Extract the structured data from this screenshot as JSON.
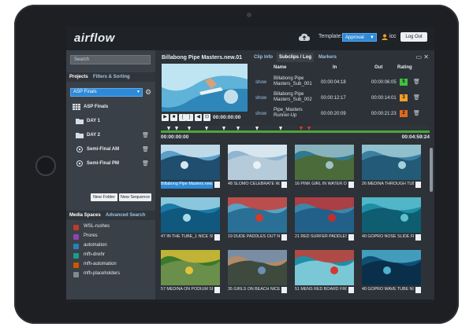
{
  "app": {
    "logo": "airflow"
  },
  "header": {
    "template_label": "Template:",
    "template_value": "Approval",
    "user": "icc",
    "logout": "Log Out"
  },
  "left": {
    "search_placeholder": "Search",
    "tabs": [
      "Projects",
      "Filters & Sorting"
    ],
    "project_select": "ASP Finals",
    "tree": [
      {
        "label": "ASP Finals",
        "icon": "grid-icon",
        "trash": false
      },
      {
        "label": "DAY 1",
        "icon": "folder-icon",
        "trash": false
      },
      {
        "label": "DAY 2",
        "icon": "folder-icon",
        "trash": true
      },
      {
        "label": "Semi-Final AM",
        "icon": "sequence-icon",
        "trash": true
      },
      {
        "label": "Semi-Final PM",
        "icon": "sequence-icon",
        "trash": true
      }
    ],
    "new_folder": "New Folder",
    "new_sequence": "New Sequence",
    "tabs2": [
      "Media Spaces",
      "Advanced Search"
    ],
    "media_spaces": [
      {
        "label": "WSL-rushes",
        "color": "#c0392b"
      },
      {
        "label": "Prores",
        "color": "#8e44ad"
      },
      {
        "label": "automation",
        "color": "#2980b9"
      },
      {
        "label": "mfh-dnxhr",
        "color": "#16a085"
      },
      {
        "label": "mfh-automation",
        "color": "#d35400"
      },
      {
        "label": "mfh-placeholders",
        "color": "#7f8c8d"
      }
    ]
  },
  "viewer": {
    "title": "Billabong Pipe Masters.new.01",
    "timecode": "00:00:00:00"
  },
  "right": {
    "tabs": [
      "Clip Info",
      "Subclips / Log",
      "Markers"
    ],
    "active_tab": 1,
    "headers": {
      "name": "Name",
      "in": "In",
      "out": "Out",
      "rating": "Rating"
    },
    "rows": [
      {
        "show": "show",
        "name": "Billabong Pipe Masters_Sub_001",
        "in": "00:00:04:18",
        "out": "00:00:06:05",
        "rating": "5",
        "rating_color": "#3fc23f"
      },
      {
        "show": "show",
        "name": "Billabong Pipe Masters_Sub_002",
        "in": "00:00:12:17",
        "out": "00:00:14:01",
        "rating": "3",
        "rating_color": "#f0a028"
      },
      {
        "show": "show",
        "name": "Pipe_Masters Runner-Up",
        "in": "00:00:20:09",
        "out": "00:00:21:23",
        "rating": "2",
        "rating_color": "#e06a1f"
      }
    ]
  },
  "timeline": {
    "start": "00:00:00:00",
    "end": "00:04:59:24"
  },
  "grid": [
    {
      "caption": "Billabong Pipe Masters.new.01",
      "selected": true,
      "colors": [
        "#5aa0c8",
        "#d7e8f0",
        "#1f4e6e"
      ]
    },
    {
      "caption": "48 SLOMO CELEBRATE WAVE",
      "selected": false,
      "colors": [
        "#8fb5d1",
        "#e9f1f6",
        "#b6cbd9"
      ]
    },
    {
      "caption": "16 PINK GIRL IN WATER OF",
      "selected": false,
      "colors": [
        "#2f7a8f",
        "#9fc2c8",
        "#4b6b3a"
      ]
    },
    {
      "caption": "26 MEDINA THROUGH TUBE",
      "selected": false,
      "colors": [
        "#3b7fa0",
        "#a6d0d8",
        "#225a78"
      ]
    },
    {
      "caption": "47 IN THE TUBE_1 NICE SURF",
      "selected": false,
      "colors": [
        "#1a7aa8",
        "#a8dbe8",
        "#10587e"
      ]
    },
    {
      "caption": "19 DUDE PADDLES OUT NICE",
      "selected": false,
      "colors": [
        "#5ba1c2",
        "#d23a2e",
        "#2a6f96"
      ]
    },
    {
      "caption": "21 RED SURFER PADDLES OUT",
      "selected": false,
      "colors": [
        "#3d87a6",
        "#c52d2d",
        "#22608a"
      ]
    },
    {
      "caption": "40 GOPRO NOSE SLIDE FRONT",
      "selected": false,
      "colors": [
        "#1d8ea6",
        "#5fc1cf",
        "#0e5d70"
      ]
    },
    {
      "caption": "57 MEDINA ON PODIUM SPARK",
      "selected": false,
      "colors": [
        "#3a7a2a",
        "#e3c23a",
        "#6a8f4a"
      ]
    },
    {
      "caption": "35 GIRLS ON BEACH NICE",
      "selected": false,
      "colors": [
        "#b38a6a",
        "#6a8fb3",
        "#3d4a3d"
      ]
    },
    {
      "caption": "51 MENS RED BOARD FRONT",
      "selected": false,
      "colors": [
        "#1f8fa8",
        "#d23a2e",
        "#7ac8d6"
      ]
    },
    {
      "caption": "40 GOPRO WAVE TUBE NICE",
      "selected": false,
      "colors": [
        "#0f4f74",
        "#4fb0d0",
        "#0a2f4a"
      ]
    }
  ]
}
